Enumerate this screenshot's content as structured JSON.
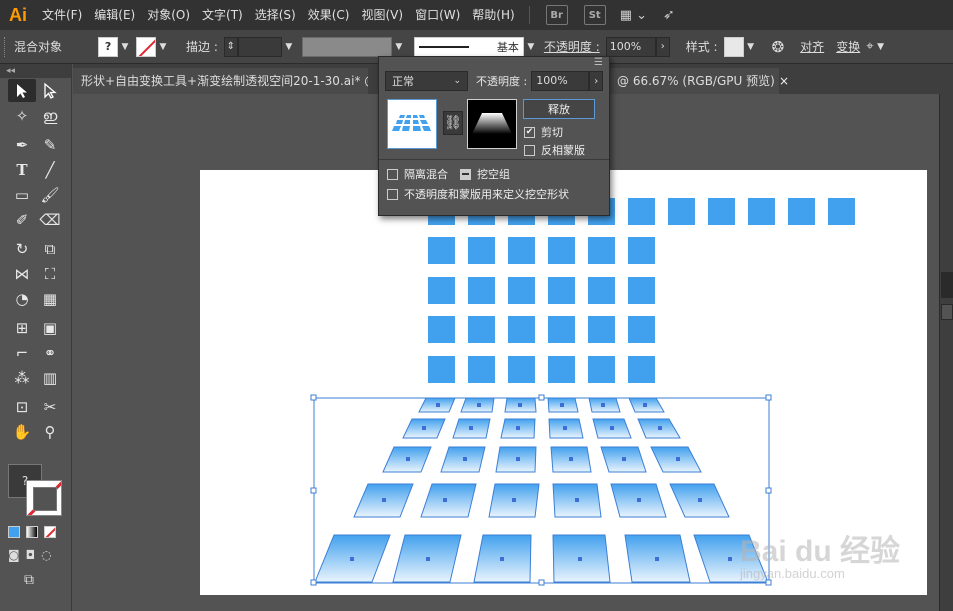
{
  "app": {
    "logo": "Ai"
  },
  "menus": [
    "文件(F)",
    "编辑(E)",
    "对象(O)",
    "文字(T)",
    "选择(S)",
    "效果(C)",
    "视图(V)",
    "窗口(W)",
    "帮助(H)"
  ],
  "app_buttons": {
    "bridge": "Br",
    "stock": "St"
  },
  "control": {
    "group_label": "混合对象",
    "fill_value": "?",
    "stroke_label": "描边 :",
    "stroke_value": "",
    "brush_label": "基本",
    "opacity_label": "不透明度 :",
    "opacity_value": "100%",
    "style_label": "样式 :",
    "align_label": "对齐",
    "transform_label": "变换"
  },
  "tabs": {
    "active_title": "形状+自由变换工具+渐变绘制透视空间20-1-30.ai* @",
    "zoom_info": "@ 66.67% (RGB/GPU 预览)",
    "close_glyph": "×"
  },
  "transparency": {
    "blend_mode": "正常",
    "opacity_label": "不透明度 :",
    "opacity_value": "100%",
    "release_button": "释放",
    "clip_label": "剪切",
    "clip_checked": true,
    "invert_label": "反相蒙版",
    "invert_checked": false,
    "isolate_label": "隔离混合",
    "knockout_label": "挖空组",
    "opacity_mask_label": "不透明度和蒙版用来定义挖空形状"
  },
  "fill_stroke": {
    "fill_value": "?"
  },
  "watermark": {
    "main": "Bai du 经验",
    "sub": "jingyan.baidu.com"
  },
  "colors": {
    "accent_blue": "#42a1ee",
    "reflection_light": "#dbeafa"
  },
  "icons": [
    "selection-icon",
    "direct-selection-icon",
    "magic-wand-icon",
    "lasso-icon",
    "pen-icon",
    "type-icon",
    "line-icon",
    "rectangle-icon",
    "paintbrush-icon",
    "eraser-icon",
    "rotate-icon",
    "scale-icon",
    "width-icon",
    "free-transform-icon",
    "shape-builder-icon",
    "perspective-icon",
    "mesh-icon",
    "gradient-icon",
    "eyedropper-icon",
    "blend-icon",
    "symbol-sprayer-icon",
    "graph-icon",
    "artboard-icon",
    "slice-icon",
    "hand-icon",
    "zoom-icon",
    "link-icon",
    "panel-menu-icon"
  ]
}
